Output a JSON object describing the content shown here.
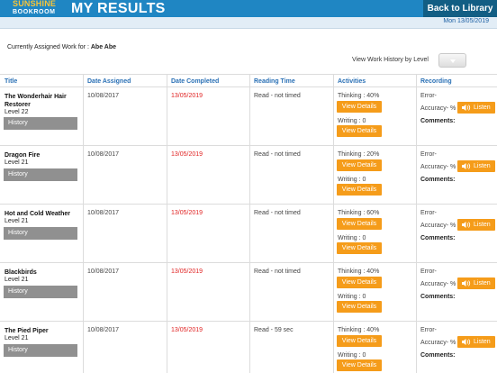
{
  "header": {
    "logo_line1": "SUNSHINE",
    "logo_line2": "BOOKROOM",
    "title": "MY RESULTS",
    "back_label": "Back to Library",
    "date": "Mon 13/05/2019"
  },
  "assigned_label": "Currently Assigned Work for : ",
  "assigned_name": "Abe Abe",
  "history_filter_label": "View Work History by Level",
  "columns": [
    "Title",
    "Date Assigned",
    "Date Completed",
    "Reading Time",
    "Activities",
    "Recording"
  ],
  "labels": {
    "history": "History",
    "view_details": "View Details",
    "error": "Error-",
    "accuracy": "Accuracy- %",
    "comments": "Comments:",
    "listen": "Listen"
  },
  "rows": [
    {
      "title": "The Wonderhair Hair Restorer",
      "level": "Level 22",
      "date_assigned": "10/08/2017",
      "date_completed": "13/05/2019",
      "reading_time": "Read - not timed",
      "thinking": "Thinking : 40%",
      "writing": "Writing : 0"
    },
    {
      "title": "Dragon Fire",
      "level": "Level 21",
      "date_assigned": "10/08/2017",
      "date_completed": "13/05/2019",
      "reading_time": "Read - not timed",
      "thinking": "Thinking : 20%",
      "writing": "Writing : 0"
    },
    {
      "title": "Hot and Cold Weather",
      "level": "Level 21",
      "date_assigned": "10/08/2017",
      "date_completed": "13/05/2019",
      "reading_time": "Read - not timed",
      "thinking": "Thinking : 60%",
      "writing": "Writing : 0"
    },
    {
      "title": "Blackbirds",
      "level": "Level 21",
      "date_assigned": "10/08/2017",
      "date_completed": "13/05/2019",
      "reading_time": "Read - not timed",
      "thinking": "Thinking : 40%",
      "writing": "Writing : 0"
    },
    {
      "title": "The Pied Piper",
      "level": "Level 21",
      "date_assigned": "10/08/2017",
      "date_completed": "13/05/2019",
      "reading_time": "Read - 59 sec",
      "thinking": "Thinking : 40%",
      "writing": "Writing : 0"
    }
  ],
  "colors": {
    "topbar": "#1f86c3",
    "back_button": "#125e84",
    "logo_accent": "#f6c43a",
    "orange_button": "#f59c1a",
    "history_button": "#909090",
    "date_completed": "#e02424",
    "column_header": "#2a70b5"
  },
  "icons": [
    "speaker-icon",
    "dropdown-arrow-icon"
  ]
}
